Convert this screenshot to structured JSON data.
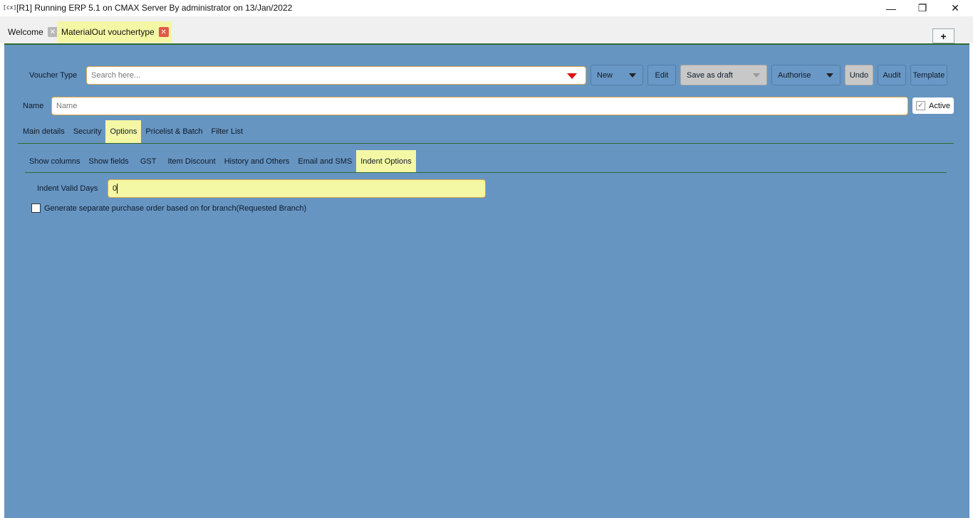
{
  "window": {
    "icon_text": "[cx]",
    "title": "[R1] Running ERP 5.1 on CMAX Server By administrator on 13/Jan/2022"
  },
  "tabs": [
    {
      "label": "Welcome"
    },
    {
      "label": "MaterialOut vouchertype"
    }
  ],
  "toolbar": {
    "voucher_type_label": "Voucher Type",
    "search_placeholder": "Search here...",
    "new": "New",
    "edit": "Edit",
    "save_as_draft": "Save as draft",
    "authorise": "Authorise",
    "undo": "Undo",
    "audit": "Audit",
    "template": "Template"
  },
  "name_row": {
    "label": "Name",
    "placeholder": "Name",
    "active_label": "Active",
    "active_checked": true
  },
  "main_tabs": [
    "Main details",
    "Security",
    "Options",
    "Pricelist & Batch",
    "Filter List"
  ],
  "main_tab_selected": "Options",
  "sub_tabs": [
    "Show columns",
    "Show fields",
    "GST",
    "Item Discount",
    "History and Others",
    "Email and SMS",
    "Indent Options"
  ],
  "sub_tab_selected": "Indent Options",
  "indent": {
    "valid_days_label": "Indent Valid Days",
    "valid_days_value": "0",
    "separate_po_label": "Generate separate purchase order based on for branch(Requested Branch)",
    "separate_po_checked": false
  },
  "colors": {
    "panel": "#6795c2",
    "highlight": "#f4f7a4",
    "accent_line": "#2f6b2f"
  }
}
